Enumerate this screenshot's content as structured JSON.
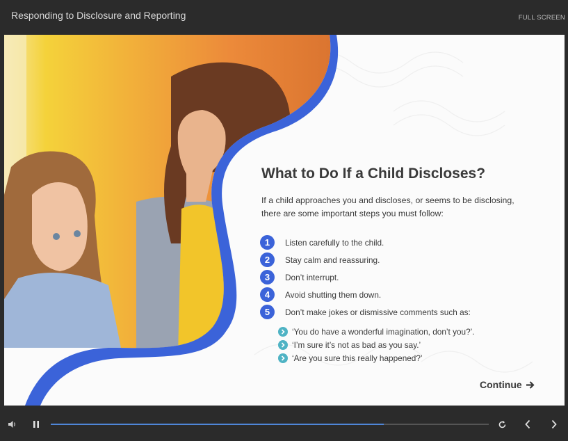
{
  "header": {
    "title": "Responding to Disclosure and Reporting",
    "fullscreen_label": "FULL SCREEN"
  },
  "slide": {
    "heading": "What to Do If a Child Discloses?",
    "intro": "If a child approaches you and discloses, or seems to be disclosing, there are some important steps you must follow:",
    "steps": [
      {
        "num": "1",
        "text": "Listen carefully to the child."
      },
      {
        "num": "2",
        "text": "Stay calm and reassuring."
      },
      {
        "num": "3",
        "text": "Don’t interrupt."
      },
      {
        "num": "4",
        "text": "Avoid shutting them down."
      },
      {
        "num": "5",
        "text": "Don’t make jokes or dismissive comments such as:"
      }
    ],
    "quotes": [
      "‘You do have a wonderful imagination, don’t you?’.",
      "‘I’m sure it’s not as bad as you say.’",
      "‘Are you sure this really happened?’"
    ],
    "continue_label": "Continue"
  },
  "player": {
    "progress": 0.76,
    "icons": {
      "volume": "volume-icon",
      "pause": "pause-icon",
      "replay": "replay-icon",
      "prev": "chevron-left-icon",
      "next": "chevron-right-icon"
    }
  },
  "colors": {
    "accent_blue": "#3b63d9",
    "quote_bullet": "#4fb3c4",
    "progress_fill": "#4f86d8",
    "chrome_bg": "#2b2b2b"
  }
}
